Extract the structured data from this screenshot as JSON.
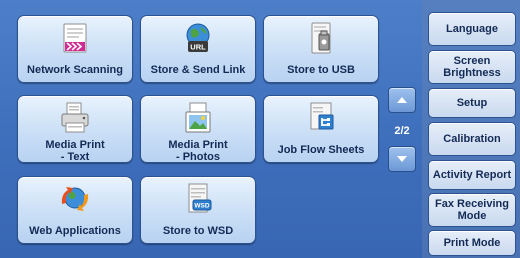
{
  "tiles": [
    {
      "label": "Network Scanning",
      "icon": "network-scanning-icon"
    },
    {
      "label": "Store & Send Link",
      "icon": "url-globe-icon"
    },
    {
      "label": "Store to USB",
      "icon": "usb-storage-icon"
    },
    {
      "label": "Media Print\n- Text",
      "icon": "printer-media-icon"
    },
    {
      "label": "Media Print\n- Photos",
      "icon": "photo-print-icon"
    },
    {
      "label": "Job Flow Sheets",
      "icon": "job-flow-sheet-icon"
    },
    {
      "label": "Web Applications",
      "icon": "globe-arrows-icon"
    },
    {
      "label": "Store to WSD",
      "icon": "wsd-icon",
      "badge": "WSD"
    }
  ],
  "url_badge": "URL",
  "pager": {
    "indicator": "2/2"
  },
  "side": {
    "language": "Language",
    "screen_brightness": "Screen\nBrightness",
    "setup": "Setup",
    "calibration": "Calibration",
    "activity_report": "Activity Report",
    "fax_receiving_mode": "Fax Receiving\nMode",
    "print_mode": "Print Mode"
  },
  "colors": {
    "panel": "#4276c1",
    "tile": "#cfe2f7",
    "text": "#142b56",
    "accent_magenta": "#c8208c"
  }
}
